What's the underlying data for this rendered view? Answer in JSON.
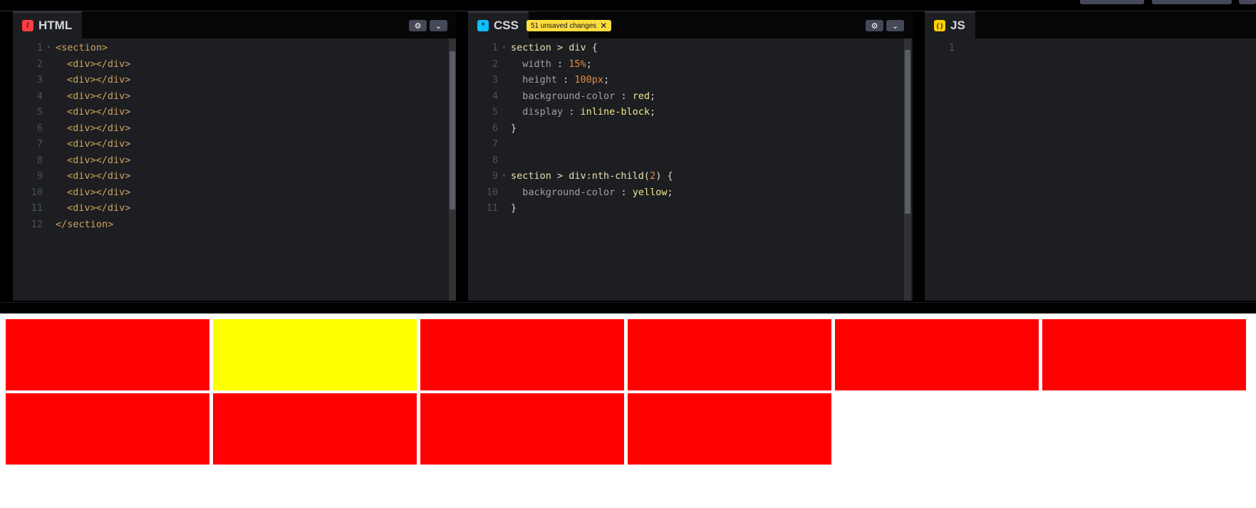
{
  "panes": {
    "html": {
      "title": "HTML",
      "icon": "/",
      "icon_color": "#ff3c41"
    },
    "css": {
      "title": "CSS",
      "icon": "*",
      "icon_color": "#0ebeff",
      "badge": "51 unsaved changes",
      "badge_close": "✕"
    },
    "js": {
      "title": "JS",
      "icon": "( )",
      "icon_color": "#fcd000"
    }
  },
  "buttons": {
    "settings": "⚙",
    "collapse": "⌄"
  },
  "html_code": [
    {
      "n": "1",
      "text": "<section>",
      "indent": 0,
      "fold": true
    },
    {
      "n": "2",
      "text": "<div></div>",
      "indent": 1
    },
    {
      "n": "3",
      "text": "<div></div>",
      "indent": 1
    },
    {
      "n": "4",
      "text": "<div></div>",
      "indent": 1
    },
    {
      "n": "5",
      "text": "<div></div>",
      "indent": 1
    },
    {
      "n": "6",
      "text": "<div></div>",
      "indent": 1
    },
    {
      "n": "7",
      "text": "<div></div>",
      "indent": 1
    },
    {
      "n": "8",
      "text": "<div></div>",
      "indent": 1
    },
    {
      "n": "9",
      "text": "<div></div>",
      "indent": 1
    },
    {
      "n": "10",
      "text": "<div></div>",
      "indent": 1
    },
    {
      "n": "11",
      "text": "<div></div>",
      "indent": 1
    },
    {
      "n": "12",
      "text": "</section>",
      "indent": 0
    }
  ],
  "css_code": [
    {
      "n": "1",
      "fold": true,
      "parts": [
        [
          "sel",
          "section > div "
        ],
        [
          "punc",
          "{"
        ]
      ]
    },
    {
      "n": "2",
      "parts": [
        [
          "prop",
          "  width "
        ],
        [
          "punc",
          ": "
        ],
        [
          "num",
          "15%"
        ],
        [
          "punc",
          ";"
        ]
      ]
    },
    {
      "n": "3",
      "parts": [
        [
          "prop",
          "  height "
        ],
        [
          "punc",
          ": "
        ],
        [
          "num",
          "100px"
        ],
        [
          "punc",
          ";"
        ]
      ]
    },
    {
      "n": "4",
      "parts": [
        [
          "prop",
          "  background-color "
        ],
        [
          "punc",
          ": "
        ],
        [
          "val",
          "red"
        ],
        [
          "punc",
          ";"
        ]
      ]
    },
    {
      "n": "5",
      "parts": [
        [
          "prop",
          "  display "
        ],
        [
          "punc",
          ": "
        ],
        [
          "val",
          "inline-block"
        ],
        [
          "punc",
          ";"
        ]
      ]
    },
    {
      "n": "6",
      "parts": [
        [
          "punc",
          "}"
        ]
      ]
    },
    {
      "n": "7",
      "parts": []
    },
    {
      "n": "8",
      "parts": []
    },
    {
      "n": "9",
      "fold": true,
      "parts": [
        [
          "sel",
          "section > div:nth-child("
        ],
        [
          "num",
          "2"
        ],
        [
          "sel",
          ") "
        ],
        [
          "punc",
          "{"
        ]
      ]
    },
    {
      "n": "10",
      "parts": [
        [
          "prop",
          "  background-color "
        ],
        [
          "punc",
          ": "
        ],
        [
          "val",
          "yellow"
        ],
        [
          "punc",
          ";"
        ]
      ]
    },
    {
      "n": "11",
      "parts": [
        [
          "punc",
          "}"
        ]
      ]
    }
  ],
  "js_code": [
    {
      "n": "1",
      "parts": []
    }
  ],
  "preview": {
    "boxes": [
      "#ff0000",
      "#ffff00",
      "#ff0000",
      "#ff0000",
      "#ff0000",
      "#ff0000",
      "#ff0000",
      "#ff0000",
      "#ff0000",
      "#ff0000"
    ]
  }
}
